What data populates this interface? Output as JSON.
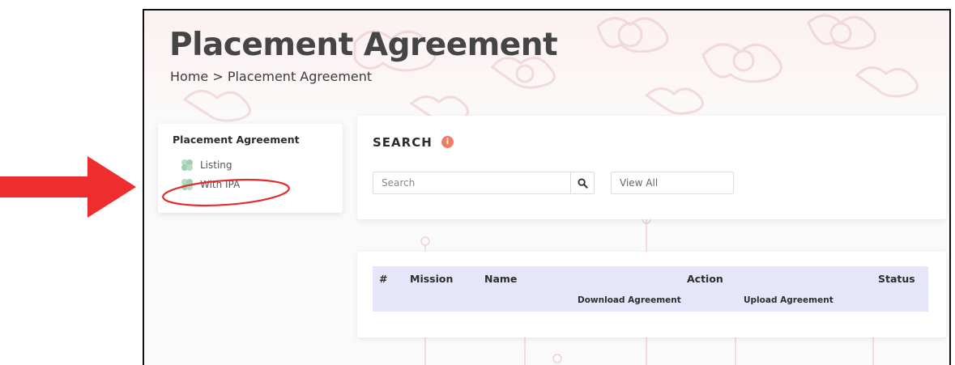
{
  "page": {
    "title": "Placement Agreement",
    "breadcrumb": "Home > Placement Agreement"
  },
  "sidebar": {
    "title": "Placement Agreement",
    "items": [
      {
        "label": "Listing",
        "icon": "clover-icon"
      },
      {
        "label": "With IPA",
        "icon": "clover-icon"
      }
    ]
  },
  "search": {
    "title": "SEARCH",
    "info_icon": "info-icon",
    "placeholder": "Search",
    "button_icon": "search-icon",
    "view_option": "View All"
  },
  "table": {
    "columns": {
      "index": "#",
      "mission": "Mission",
      "name": "Name",
      "action": "Action",
      "status": "Status"
    },
    "action_subcolumns": {
      "download": "Download Agreement",
      "upload": "Upload Agreement"
    }
  },
  "colors": {
    "annotation_red": "#ee2e2e",
    "info_orange": "#f07c62",
    "table_header": "#e6e6fb",
    "title_text": "#454545"
  }
}
